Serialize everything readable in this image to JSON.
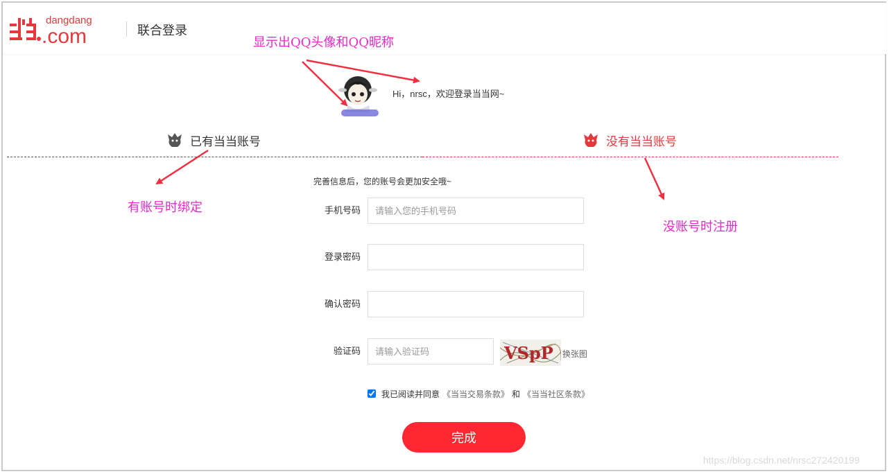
{
  "header": {
    "logo_brand": "dangdang",
    "logo_domain": ".com",
    "title": "联合登录"
  },
  "profile": {
    "greeting": "Hi，nrsc，欢迎登录当当网~"
  },
  "tabs": {
    "existing_account": "已有当当账号",
    "no_account": "没有当当账号"
  },
  "form": {
    "hint": "完善信息后，您的账号会更加安全哦~",
    "phone_label": "手机号码",
    "phone_placeholder": "请输入您的手机号码",
    "phone_value": "",
    "password_label": "登录密码",
    "password_value": "",
    "confirm_label": "确认密码",
    "confirm_value": "",
    "captcha_label": "验证码",
    "captcha_placeholder": "请输入验证码",
    "captcha_value": "",
    "captcha_text": "VSpP",
    "captcha_refresh": "换张图",
    "agree_checked": true,
    "agree_text": "我已阅读并同意",
    "terms_trade": "《当当交易条款》",
    "agree_and": "和",
    "terms_community": "《当当社区条款》",
    "submit_label": "完成"
  },
  "annotations": {
    "avatar_note": "显示出QQ头像和QQ昵称",
    "bind_note": "有账号时绑定",
    "register_note": "没账号时注册"
  },
  "watermark": "https://blog.csdn.net/nrsc272420199",
  "colors": {
    "brand_red": "#e4393c",
    "button_red": "#ff2832",
    "annotation_magenta": "#e628c8"
  }
}
